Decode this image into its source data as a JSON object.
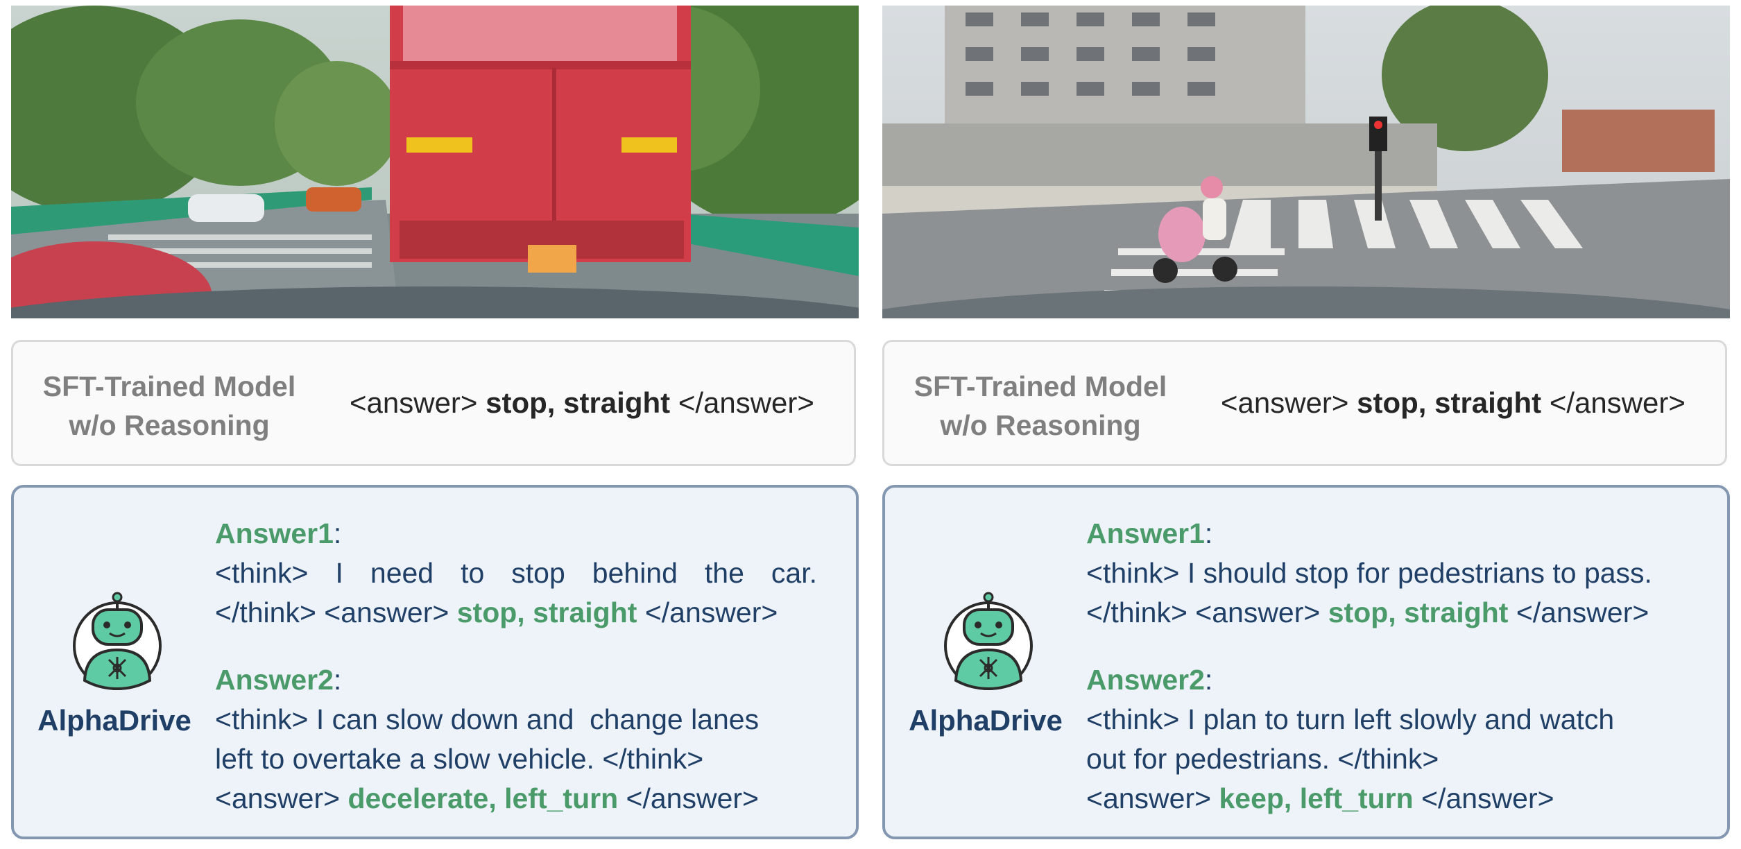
{
  "panels": [
    {
      "sft": {
        "model_line1": "SFT-Trained Model",
        "model_line2": "w/o Reasoning",
        "open_tag": "<answer>",
        "answer": "stop, straight",
        "close_tag": "</answer>"
      },
      "alphadrive": {
        "name": "AlphaDrive",
        "answer1": {
          "heading": "Answer1",
          "think": "<think> I need to stop behind the car.",
          "think_end": "</think> <answer>",
          "answer": "stop, straight",
          "answer_end": "</answer>"
        },
        "answer2": {
          "heading": "Answer2",
          "line1": "<think> I can slow down and  change lanes",
          "line2": "left to overtake a slow vehicle. </think>",
          "open_tag": "<answer>",
          "answer": "decelerate, left_turn",
          "close_tag": "</answer>"
        }
      }
    },
    {
      "sft": {
        "model_line1": "SFT-Trained Model",
        "model_line2": "w/o Reasoning",
        "open_tag": "<answer>",
        "answer": "stop, straight",
        "close_tag": "</answer>"
      },
      "alphadrive": {
        "name": "AlphaDrive",
        "answer1": {
          "heading": "Answer1",
          "think": "<think> I should stop for pedestrians to pass.",
          "think_end": "</think> <answer>",
          "answer": "stop, straight",
          "answer_end": "</answer>"
        },
        "answer2": {
          "heading": "Answer2",
          "line1": "<think> I plan to turn left slowly and watch",
          "line2": "out for pedestrians. </think>",
          "open_tag": "<answer>",
          "answer": "keep, left_turn",
          "close_tag": "</answer>"
        }
      }
    }
  ],
  "colors": {
    "accent_green": "#4a9a6a",
    "navy_text": "#1f3f66",
    "gray_label": "#7f7f7f",
    "box_border": "#8497b0",
    "box_fill": "#eef3f9"
  },
  "icons": [
    "robot-avatar-icon"
  ]
}
